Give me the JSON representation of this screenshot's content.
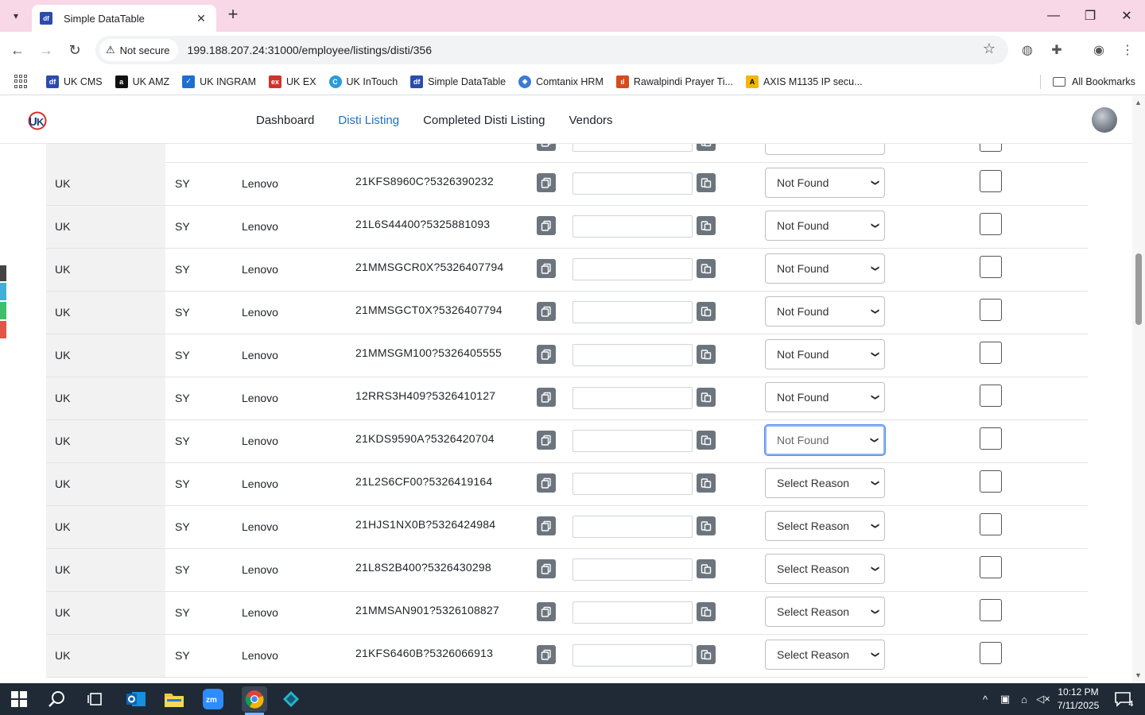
{
  "browser": {
    "tab_title": "Simple DataTable",
    "tab_favicon_text": "df",
    "security_label": "Not secure",
    "url": "199.188.207.24:31000/employee/listings/disti/356",
    "bookmarks": [
      {
        "label": "UK CMS",
        "color": "#2a4cad",
        "glyph": "df"
      },
      {
        "label": "UK AMZ",
        "color": "#111111",
        "glyph": "a"
      },
      {
        "label": "UK INGRAM",
        "color": "#1f6fd1",
        "glyph": "✓"
      },
      {
        "label": "UK EX",
        "color": "#d0332b",
        "glyph": "ex"
      },
      {
        "label": "UK InTouch",
        "color": "#2a9bd8",
        "glyph": "C"
      },
      {
        "label": "Simple DataTable",
        "color": "#2a4cad",
        "glyph": "df"
      },
      {
        "label": "Comtanix HRM",
        "color": "#3a7bd5",
        "glyph": "◆"
      },
      {
        "label": "Rawalpindi Prayer Ti...",
        "color": "#d84a1b",
        "glyph": "ıl"
      },
      {
        "label": "AXIS M1135 IP secu...",
        "color": "#f2b705",
        "glyph": "A"
      }
    ],
    "all_bookmarks_label": "All Bookmarks"
  },
  "app": {
    "nav": [
      {
        "label": "Dashboard",
        "active": false
      },
      {
        "label": "Disti Listing",
        "active": true
      },
      {
        "label": "Completed Disti Listing",
        "active": false
      },
      {
        "label": "Vendors",
        "active": false
      }
    ]
  },
  "table": {
    "rows": [
      {
        "country": "UK",
        "code": "SY",
        "brand": "Lenovo",
        "sku": "21KFS8960C?5326390232",
        "reason": "Not Found",
        "focused": false
      },
      {
        "country": "UK",
        "code": "SY",
        "brand": "Lenovo",
        "sku": "21L6S44400?5325881093",
        "reason": "Not Found",
        "focused": false
      },
      {
        "country": "UK",
        "code": "SY",
        "brand": "Lenovo",
        "sku": "21MMSGCR0X?5326407794",
        "reason": "Not Found",
        "focused": false
      },
      {
        "country": "UK",
        "code": "SY",
        "brand": "Lenovo",
        "sku": "21MMSGCT0X?5326407794",
        "reason": "Not Found",
        "focused": false
      },
      {
        "country": "UK",
        "code": "SY",
        "brand": "Lenovo",
        "sku": "21MMSGM100?5326405555",
        "reason": "Not Found",
        "focused": false
      },
      {
        "country": "UK",
        "code": "SY",
        "brand": "Lenovo",
        "sku": "12RRS3H409?5326410127",
        "reason": "Not Found",
        "focused": false
      },
      {
        "country": "UK",
        "code": "SY",
        "brand": "Lenovo",
        "sku": "21KDS9590A?5326420704",
        "reason": "Not Found",
        "focused": true
      },
      {
        "country": "UK",
        "code": "SY",
        "brand": "Lenovo",
        "sku": "21L2S6CF00?5326419164",
        "reason": "Select Reason",
        "focused": false
      },
      {
        "country": "UK",
        "code": "SY",
        "brand": "Lenovo",
        "sku": "21HJS1NX0B?5326424984",
        "reason": "Select Reason",
        "focused": false
      },
      {
        "country": "UK",
        "code": "SY",
        "brand": "Lenovo",
        "sku": "21L8S2B400?5326430298",
        "reason": "Select Reason",
        "focused": false
      },
      {
        "country": "UK",
        "code": "SY",
        "brand": "Lenovo",
        "sku": "21MMSAN901?5326108827",
        "reason": "Select Reason",
        "focused": false
      },
      {
        "country": "UK",
        "code": "SY",
        "brand": "Lenovo",
        "sku": "21KFS6460B?5326066913",
        "reason": "Select Reason",
        "focused": false
      }
    ]
  },
  "taskbar": {
    "time": "10:12 PM",
    "date": "7/11/2025",
    "notification_count": "4"
  }
}
